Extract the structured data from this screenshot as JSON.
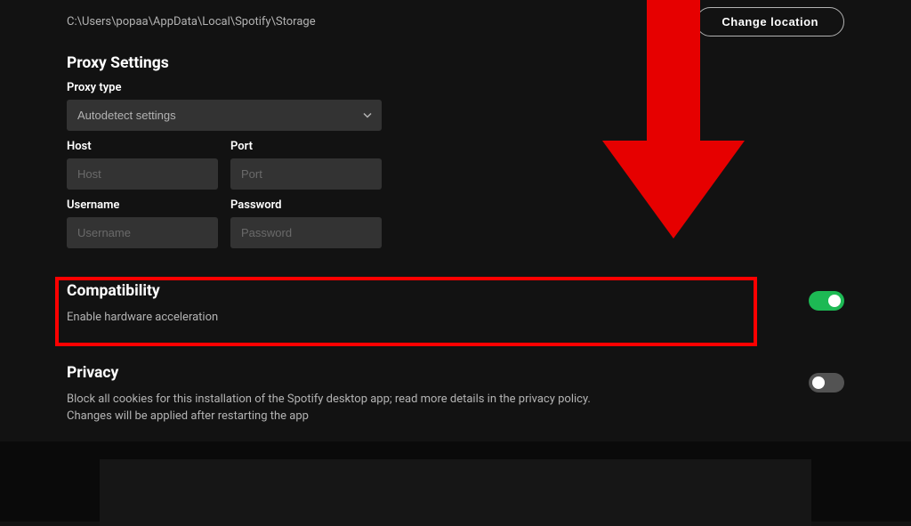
{
  "storage": {
    "path": "C:\\Users\\popaa\\AppData\\Local\\Spotify\\Storage",
    "change_button": "Change location"
  },
  "proxy": {
    "title": "Proxy Settings",
    "type_label": "Proxy type",
    "type_value": "Autodetect settings",
    "host_label": "Host",
    "host_placeholder": "Host",
    "port_label": "Port",
    "port_placeholder": "Port",
    "username_label": "Username",
    "username_placeholder": "Username",
    "password_label": "Password",
    "password_placeholder": "Password"
  },
  "compatibility": {
    "title": "Compatibility",
    "hw_accel_label": "Enable hardware acceleration",
    "hw_accel_enabled": true
  },
  "privacy": {
    "title": "Privacy",
    "cookies_desc": "Block all cookies for this installation of the Spotify desktop app; read more details in the privacy policy. Changes will be applied after restarting the app",
    "cookies_enabled": false
  },
  "annotation": {
    "highlight_color": "#ff0000",
    "arrow_color": "#ff0000"
  }
}
